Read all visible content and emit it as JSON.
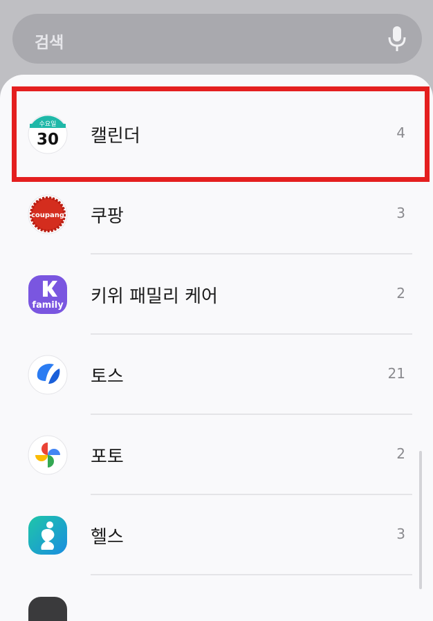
{
  "search": {
    "placeholder": "검색"
  },
  "apps": [
    {
      "name": "캘린더",
      "count": "4",
      "icon": "calendar-icon"
    },
    {
      "name": "쿠팡",
      "count": "3",
      "icon": "coupang-icon"
    },
    {
      "name": "키위 패밀리 케어",
      "count": "2",
      "icon": "kiwi-family-icon"
    },
    {
      "name": "토스",
      "count": "21",
      "icon": "toss-icon"
    },
    {
      "name": "포토",
      "count": "2",
      "icon": "photos-icon"
    },
    {
      "name": "헬스",
      "count": "3",
      "icon": "health-icon"
    }
  ],
  "icon_text": {
    "calendar_weekday": "수요일",
    "calendar_day": "30",
    "coupang": "coupang",
    "kiwi": "family"
  },
  "colors": {
    "highlight": "#e41f1f",
    "calendar_teal": "#1fb8a8"
  }
}
